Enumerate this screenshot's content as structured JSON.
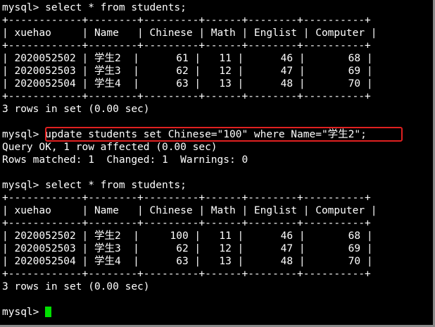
{
  "terminal": {
    "highlight_color": "#e02020",
    "cursor_color": "#00e000",
    "text_color": "#ffffff",
    "background": "#000000",
    "lines": [
      "mysql> select * from students;",
      "+------------+--------+---------+------+--------+----------+",
      "| xuehao     | Name   | Chinese | Math | Englist | Computer |",
      "+------------+--------+---------+------+--------+----------+",
      "| 2020052502 | 学生2  |      61 |   11 |      46 |       68 |",
      "| 2020052503 | 学生3  |      62 |   12 |      47 |       69 |",
      "| 2020052504 | 学生4  |      63 |   13 |      48 |       70 |",
      "+------------+--------+---------+------+--------+----------+",
      "3 rows in set (0.00 sec)",
      "",
      "mysql> update students set Chinese=\"100\" where Name=\"学生2\";",
      "Query OK, 1 row affected (0.00 sec)",
      "Rows matched: 1  Changed: 1  Warnings: 0",
      "",
      "mysql> select * from students;",
      "+------------+--------+---------+------+--------+----------+",
      "| xuehao     | Name   | Chinese | Math | Englist | Computer |",
      "+------------+--------+---------+------+--------+----------+",
      "| 2020052502 | 学生2  |     100 |   11 |      46 |       68 |",
      "| 2020052503 | 学生3  |      62 |   12 |      47 |       69 |",
      "| 2020052504 | 学生4  |      63 |   13 |      48 |       70 |",
      "+------------+--------+---------+------+--------+----------+",
      "3 rows in set (0.00 sec)",
      "",
      "mysql> "
    ]
  }
}
